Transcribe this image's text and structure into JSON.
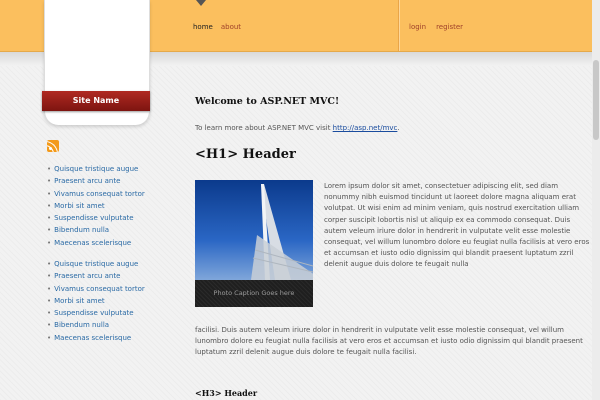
{
  "nav": {
    "home": "home",
    "about": "about"
  },
  "auth": {
    "login": "login",
    "register": "register"
  },
  "sidebar": {
    "site_name": "Site Name",
    "list1": [
      "Quisque tristique augue",
      "Praesent arcu ante",
      "Vivamus consequat tortor",
      "Morbi sit amet",
      "Suspendisse vulputate",
      "Bibendum nulla",
      "Maecenas scelerisque"
    ],
    "list2": [
      "Quisque tristique augue",
      "Praesent arcu ante",
      "Vivamus consequat tortor",
      "Morbi sit amet",
      "Suspendisse vulputate",
      "Bibendum nulla",
      "Maecenas scelerisque"
    ]
  },
  "main": {
    "welcome": "Welcome to ASP.NET MVC!",
    "learn_text": "To learn more about ASP.NET MVC visit ",
    "learn_link": "http://asp.net/mvc",
    "learn_end": ".",
    "h1": "<H1> Header",
    "photo_caption": "Photo Caption Goes here",
    "para_right": "Lorem ipsum dolor sit amet, consectetuer adipiscing elit, sed diam nonummy nibh euismod tincidunt ut laoreet dolore magna aliquam erat volutpat. Ut wisi enim ad minim veniam, quis nostrud exercitation ulliam corper suscipit lobortis nisl ut aliquip ex ea commodo consequat. Duis autem veleum iriure dolor in hendrerit in vulputate velit esse molestie consequat, vel willum lunombro dolore eu feugiat nulla facilisis at vero eros et accumsan et iusto odio dignissim qui blandit praesent luptatum zzril delenit augue duis dolore te feugait nulla",
    "para_full": "facilisi. Duis autem veleum iriure dolor in hendrerit in vulputate velit esse molestie consequat, vel willum lunombro dolore eu feugiat nulla facilisis at vero eros et accumsan et iusto odio dignissim qui blandit praesent luptatum zzril delenit augue duis dolore te feugait nulla facilisi.",
    "h3": "<H3> Header"
  },
  "colors": {
    "topbar": "#fbbf5e",
    "site_name_bg": "#9a1f18",
    "link": "#2a6aa5",
    "nav_link": "#a0422a"
  },
  "icons": {
    "rss": "rss-icon"
  }
}
